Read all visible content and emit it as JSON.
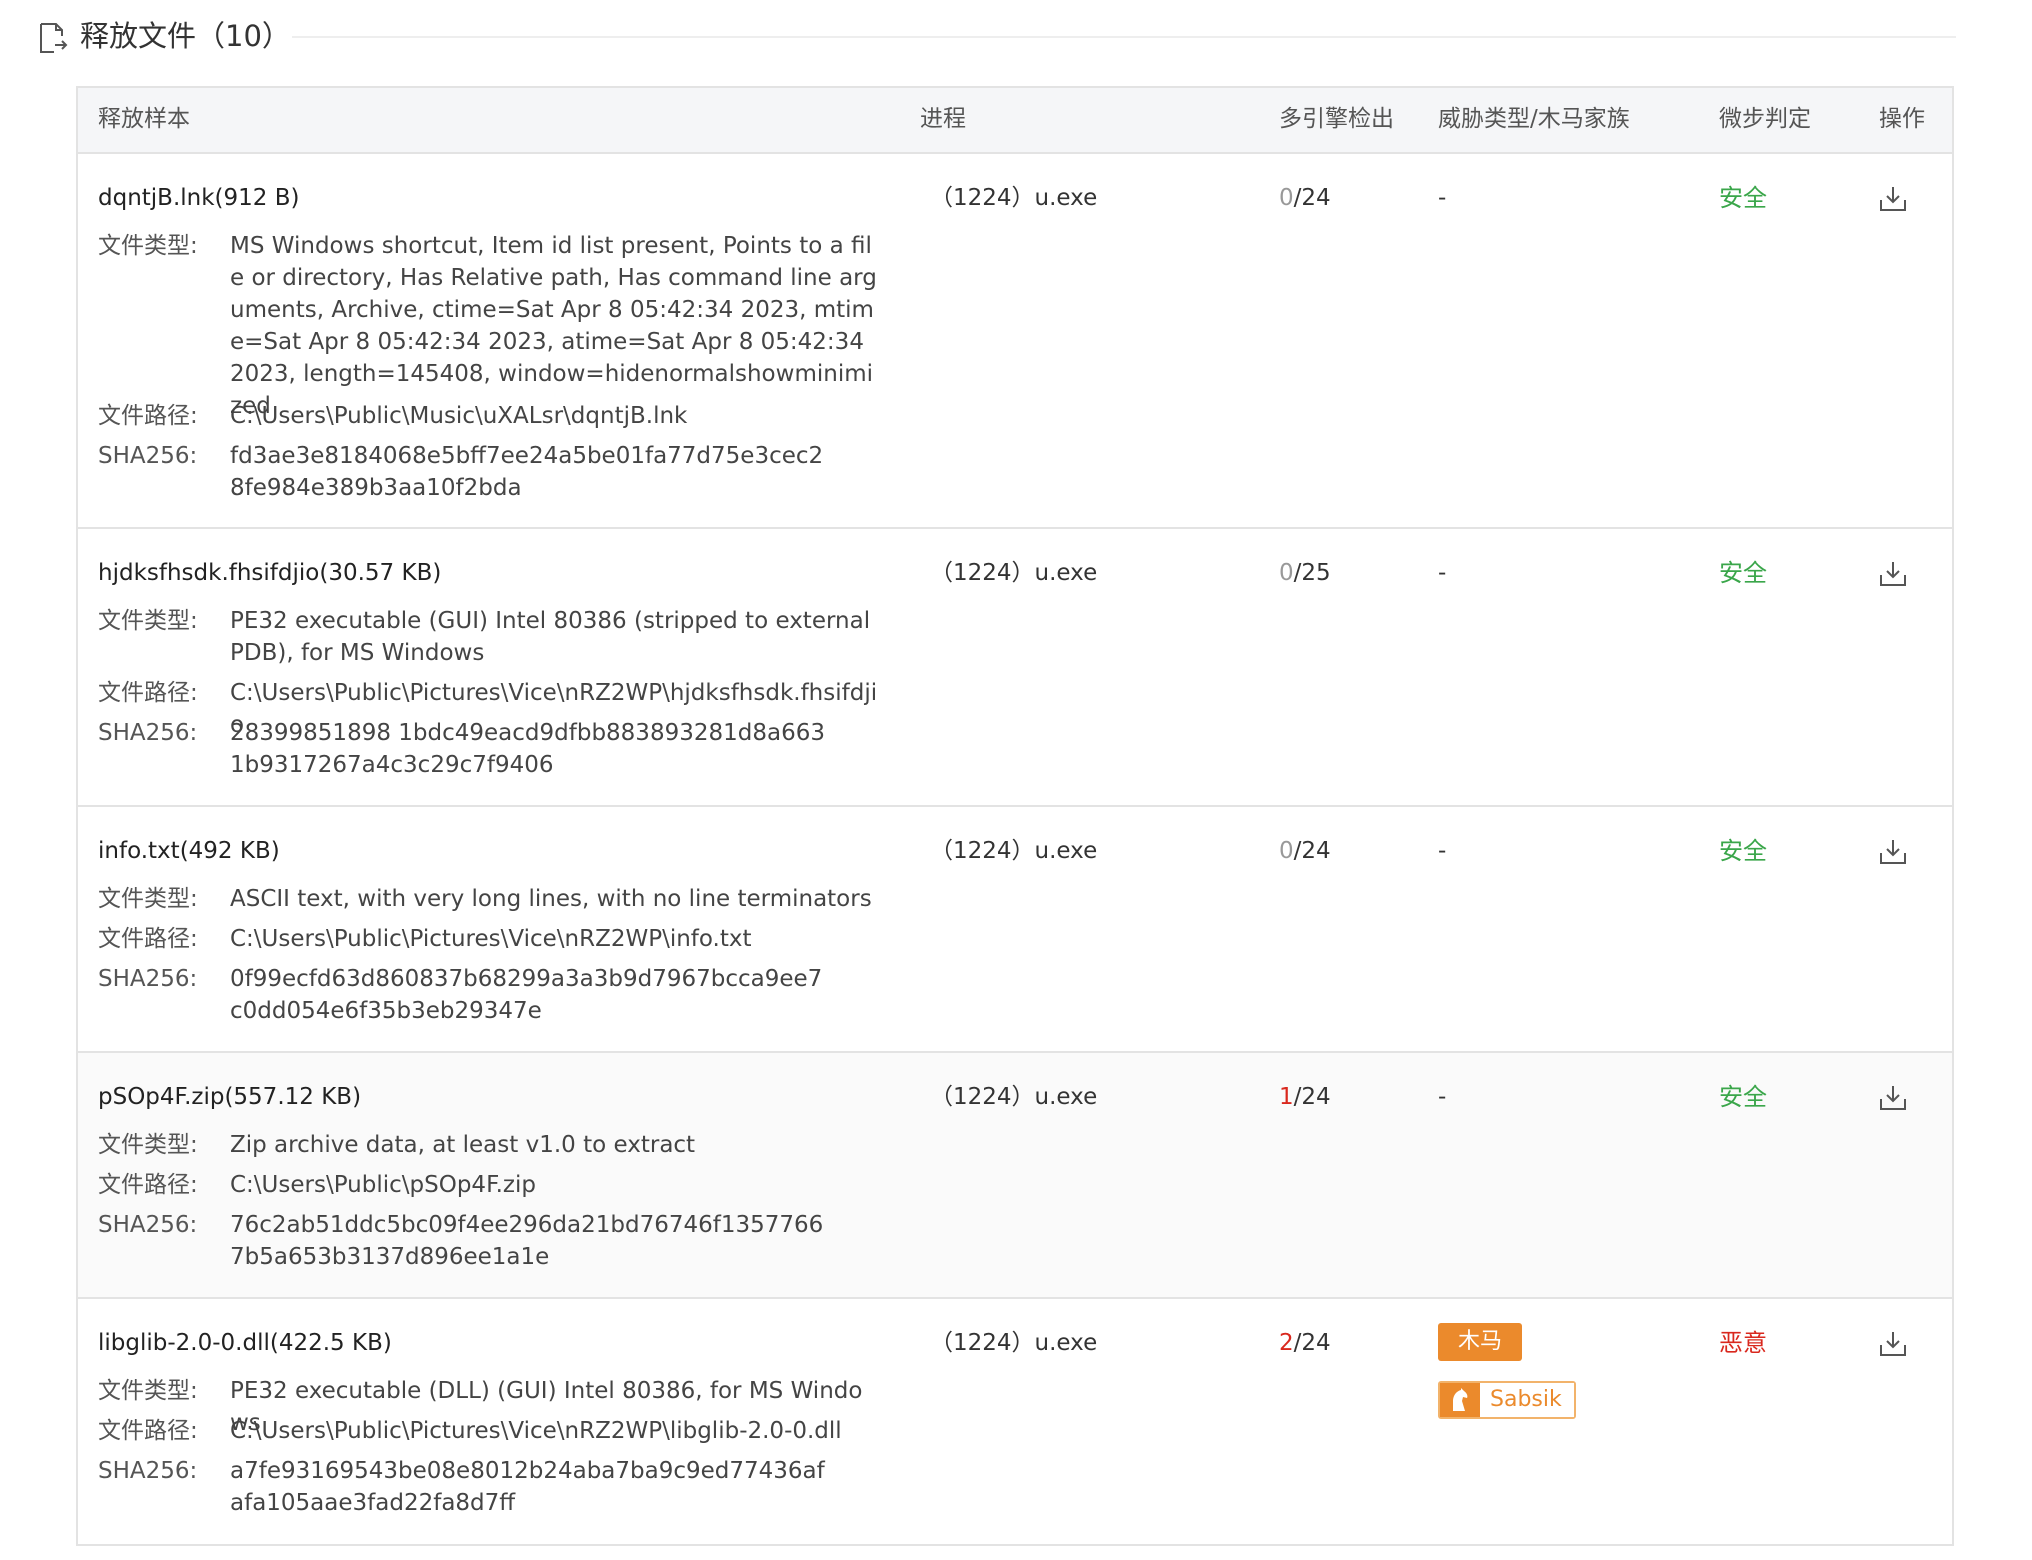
{
  "section": {
    "title": "释放文件（10）"
  },
  "table": {
    "headers": {
      "sample": "释放样本",
      "process": "进程",
      "detection": "多引擎检出",
      "threat": "威胁类型/木马家族",
      "verdict": "微步判定",
      "action": "操作"
    },
    "labels": {
      "file_type": "文件类型:",
      "file_path": "文件路径:",
      "sha256": "SHA256:"
    },
    "rows": [
      {
        "name": "dqntjB.lnk(912 B)",
        "file_type": "MS Windows shortcut, Item id list present, Points to a file or directory, Has Relative path, Has command line arguments, Archive, ctime=Sat Apr 8 05:42:34 2023, mtime=Sat Apr 8 05:42:34 2023, atime=Sat Apr 8 05:42:34 2023, length=145408, window=hidenormalshowminimized",
        "file_path": "C:\\Users\\Public\\Music\\uXALsr\\dqntjB.lnk",
        "sha256": "fd3ae3e8184068e5bff7ee24a5be01fa77d75e3cec28fe984e389b3aa10f2bda",
        "process": "（1224）u.exe",
        "det_hits": "0",
        "det_total": "/24",
        "threat": "-",
        "verdict": "安全"
      },
      {
        "name": "hjdksfhsdk.fhsifdjio(30.57 KB)",
        "file_type": "PE32 executable (GUI) Intel 80386 (stripped to external PDB), for MS Windows",
        "file_path": "C:\\Users\\Public\\Pictures\\Vice\\nRZ2WP\\hjdksfhsdk.fhsifdjio",
        "sha256": "28399851898 1bdc49eacd9dfbb883893281d8a6631b9317267a4c3c29c7f9406",
        "process": "（1224）u.exe",
        "det_hits": "0",
        "det_total": "/25",
        "threat": "-",
        "verdict": "安全"
      },
      {
        "name": "info.txt(492 KB)",
        "file_type": "ASCII text, with very long lines, with no line terminators",
        "file_path": "C:\\Users\\Public\\Pictures\\Vice\\nRZ2WP\\info.txt",
        "sha256": "0f99ecfd63d860837b68299a3a3b9d7967bcca9ee7c0dd054e6f35b3eb29347e",
        "process": "（1224）u.exe",
        "det_hits": "0",
        "det_total": "/24",
        "threat": "-",
        "verdict": "安全"
      },
      {
        "name": "pSOp4F.zip(557.12 KB)",
        "file_type": "Zip archive data, at least v1.0 to extract",
        "file_path": "C:\\Users\\Public\\pSOp4F.zip",
        "sha256": "76c2ab51ddc5bc09f4ee296da21bd76746f13577667b5a653b3137d896ee1a1e",
        "process": "（1224）u.exe",
        "det_hits": "1",
        "det_total": "/24",
        "threat": "-",
        "verdict": "安全"
      },
      {
        "name": "libglib-2.0-0.dll(422.5 KB)",
        "file_type": "PE32 executable (DLL) (GUI) Intel 80386, for MS Windows",
        "file_path": "C:\\Users\\Public\\Pictures\\Vice\\nRZ2WP\\libglib-2.0-0.dll",
        "sha256": "a7fe93169543be08e8012b24aba7ba9c9ed77436afafa105aae3fad22fa8d7ff",
        "process": "（1224）u.exe",
        "det_hits": "2",
        "det_total": "/24",
        "threat_type": "木马",
        "threat_family": "Sabsik",
        "verdict": "恶意"
      }
    ]
  },
  "colors": {
    "safe": "#3aa64a",
    "malicious": "#d9281e",
    "trojan_badge": "#eb8a2c"
  },
  "icons": {
    "section": "file-export-icon",
    "download": "download-icon",
    "family": "trojan-horse-icon"
  }
}
